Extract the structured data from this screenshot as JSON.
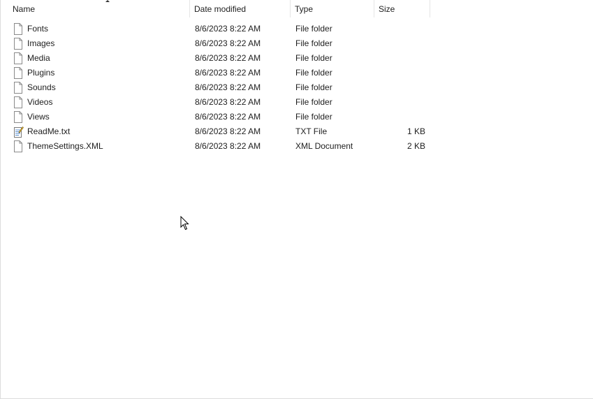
{
  "columns": {
    "name": "Name",
    "date": "Date modified",
    "type": "Type",
    "size": "Size"
  },
  "files": [
    {
      "name": "Fonts",
      "date": "8/6/2023 8:22 AM",
      "type": "File folder",
      "size": "",
      "icon": "file-icon"
    },
    {
      "name": "Images",
      "date": "8/6/2023 8:22 AM",
      "type": "File folder",
      "size": "",
      "icon": "file-icon"
    },
    {
      "name": "Media",
      "date": "8/6/2023 8:22 AM",
      "type": "File folder",
      "size": "",
      "icon": "file-icon"
    },
    {
      "name": "Plugins",
      "date": "8/6/2023 8:22 AM",
      "type": "File folder",
      "size": "",
      "icon": "file-icon"
    },
    {
      "name": "Sounds",
      "date": "8/6/2023 8:22 AM",
      "type": "File folder",
      "size": "",
      "icon": "file-icon"
    },
    {
      "name": "Videos",
      "date": "8/6/2023 8:22 AM",
      "type": "File folder",
      "size": "",
      "icon": "file-icon"
    },
    {
      "name": "Views",
      "date": "8/6/2023 8:22 AM",
      "type": "File folder",
      "size": "",
      "icon": "file-icon"
    },
    {
      "name": "ReadMe.txt",
      "date": "8/6/2023 8:22 AM",
      "type": "TXT File",
      "size": "1 KB",
      "icon": "text-file-icon"
    },
    {
      "name": "ThemeSettings.XML",
      "date": "8/6/2023 8:22 AM",
      "type": "XML Document",
      "size": "2 KB",
      "icon": "file-icon"
    }
  ]
}
